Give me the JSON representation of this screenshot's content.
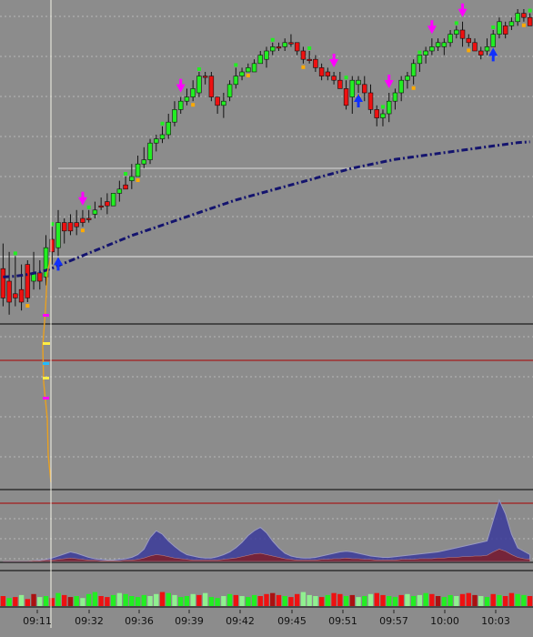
{
  "colors": {
    "background": "#8c8c8c",
    "up_candle": "#22ee22",
    "down_candle": "#ee1111",
    "moving_average": "#14146e",
    "crosshair": "#f5f5e8",
    "signal_arrow_down": "#ff00ff",
    "signal_arrow_up": "#1030ff",
    "volume_light": "#90f090",
    "volume_green": "#22ee22",
    "volume_red": "#ee1111",
    "volume_maroon": "#aa1111"
  },
  "chart_data": [
    {
      "type": "candlestick",
      "panel": "price",
      "grid": true,
      "x": [
        "09:11",
        "09:32",
        "09:36",
        "09:39",
        "09:42",
        "09:45",
        "09:51",
        "09:57",
        "10:00",
        "10:03"
      ],
      "price_scale": {
        "top": 0,
        "bottom": 100
      },
      "candles": [
        [
          62,
          69,
          56,
          71
        ],
        [
          65,
          70,
          58,
          73
        ],
        [
          68,
          69,
          59,
          71
        ],
        [
          67,
          70,
          61,
          72
        ],
        [
          61,
          69,
          60,
          70
        ],
        [
          65,
          63,
          58,
          67
        ],
        [
          63,
          65,
          60,
          67
        ],
        [
          64,
          57,
          54,
          66
        ],
        [
          55,
          58,
          52,
          61
        ],
        [
          57,
          51,
          48,
          59
        ],
        [
          51,
          53,
          50,
          56
        ],
        [
          51,
          53,
          49,
          54
        ],
        [
          51,
          52,
          48,
          54
        ],
        [
          50,
          51,
          48,
          52
        ],
        [
          50,
          50,
          48,
          51
        ],
        [
          49,
          48,
          46,
          50
        ],
        [
          47,
          47,
          45,
          48
        ],
        [
          46,
          47,
          44,
          49
        ],
        [
          47,
          44,
          44,
          45
        ],
        [
          44,
          43,
          41,
          46
        ],
        [
          42,
          43,
          40,
          43
        ],
        [
          41,
          40,
          37,
          43
        ],
        [
          40,
          37,
          35,
          40
        ],
        [
          37,
          36,
          33,
          38
        ],
        [
          36,
          32,
          31,
          37
        ],
        [
          32,
          31,
          30,
          34
        ],
        [
          31,
          30,
          28,
          32
        ],
        [
          30,
          27,
          25,
          31
        ],
        [
          27,
          24,
          22,
          28
        ],
        [
          24,
          22,
          21,
          25
        ],
        [
          22,
          21,
          19,
          23
        ],
        [
          21,
          19,
          17,
          22
        ],
        [
          20,
          16,
          15,
          21
        ],
        [
          16,
          16,
          15,
          18
        ],
        [
          16,
          21,
          15,
          22
        ],
        [
          21,
          23,
          22,
          25
        ],
        [
          23,
          22,
          20,
          26
        ],
        [
          21,
          18,
          17,
          22
        ],
        [
          18,
          16,
          14,
          19
        ],
        [
          16,
          15,
          14,
          17
        ],
        [
          15,
          14,
          13,
          15
        ],
        [
          15,
          13,
          12,
          15
        ],
        [
          13,
          11,
          10,
          13
        ],
        [
          12,
          10,
          9,
          14
        ],
        [
          10,
          9,
          8,
          11
        ],
        [
          9,
          9,
          8,
          10
        ],
        [
          9,
          8,
          7,
          10
        ],
        [
          8,
          8,
          6,
          9
        ],
        [
          8,
          10,
          8,
          11
        ],
        [
          10,
          12,
          9,
          13
        ],
        [
          12,
          12,
          10,
          13
        ],
        [
          12,
          14,
          11,
          15
        ],
        [
          14,
          16,
          13,
          17
        ],
        [
          15,
          16,
          14,
          17
        ],
        [
          16,
          17,
          15,
          18
        ],
        [
          17,
          19,
          15,
          19
        ],
        [
          19,
          23,
          17,
          24
        ],
        [
          21,
          17,
          16,
          25
        ],
        [
          18,
          17,
          16,
          20
        ],
        [
          18,
          20,
          16,
          22
        ],
        [
          20,
          24,
          18,
          25
        ],
        [
          24,
          26,
          23,
          28
        ],
        [
          26,
          25,
          24,
          28
        ],
        [
          25,
          22,
          20,
          27
        ],
        [
          22,
          20,
          19,
          24
        ],
        [
          20,
          17,
          16,
          22
        ],
        [
          17,
          16,
          15,
          19
        ],
        [
          16,
          13,
          12,
          18
        ],
        [
          13,
          11,
          11,
          15
        ],
        [
          11,
          10,
          9,
          13
        ],
        [
          10,
          9,
          7,
          11
        ],
        [
          9,
          8,
          7,
          10
        ],
        [
          9,
          8,
          7,
          11
        ],
        [
          8,
          6,
          5,
          9
        ],
        [
          6,
          5,
          4,
          7
        ],
        [
          5,
          7,
          3,
          9
        ],
        [
          7,
          8,
          6,
          9
        ],
        [
          8,
          10,
          7,
          10
        ],
        [
          10,
          11,
          9,
          12
        ],
        [
          10,
          9,
          7,
          11
        ],
        [
          9,
          6,
          5,
          9
        ],
        [
          6,
          3,
          2,
          7
        ],
        [
          4,
          6,
          3,
          7
        ],
        [
          4,
          3,
          2,
          5
        ],
        [
          3,
          1,
          0,
          4
        ],
        [
          1,
          2,
          0,
          3
        ],
        [
          2,
          4,
          1,
          4
        ]
      ],
      "moving_average": [
        64,
        63.9,
        63.8,
        63.6,
        63.4,
        63.1,
        62.8,
        62.4,
        61.9,
        61.3,
        60.7,
        60.1,
        59.5,
        58.9,
        58.3,
        57.7,
        57.1,
        56.5,
        55.9,
        55.3,
        54.7,
        54.1,
        53.6,
        53.1,
        52.6,
        52.1,
        51.6,
        51.1,
        50.6,
        50.1,
        49.6,
        49.1,
        48.6,
        48.1,
        47.6,
        47.1,
        46.6,
        46.1,
        45.6,
        45.2,
        44.8,
        44.4,
        44.0,
        43.6,
        43.2,
        42.8,
        42.4,
        42.0,
        41.6,
        41.2,
        40.8,
        40.4,
        40.0,
        39.6,
        39.2,
        38.8,
        38.4,
        38.0,
        37.7,
        37.4,
        37.1,
        36.8,
        36.5,
        36.2,
        35.9,
        35.7,
        35.5,
        35.3,
        35.1,
        34.9,
        34.7,
        34.5,
        34.3,
        34.1,
        33.9,
        33.7,
        33.5,
        33.3,
        33.1,
        32.9,
        32.7,
        32.5,
        32.3,
        32.1,
        31.9,
        31.8,
        31.7
      ],
      "signals": [
        {
          "index": 13,
          "dir": "down"
        },
        {
          "index": 29,
          "dir": "down"
        },
        {
          "index": 54,
          "dir": "down"
        },
        {
          "index": 63,
          "dir": "down"
        },
        {
          "index": 70,
          "dir": "down"
        },
        {
          "index": 75,
          "dir": "down"
        },
        {
          "index": 9,
          "dir": "up"
        },
        {
          "index": 58,
          "dir": "up"
        },
        {
          "index": 80,
          "dir": "up"
        }
      ]
    },
    {
      "type": "area",
      "panel": "indicator",
      "series": [
        {
          "values": [
            0,
            0,
            0,
            0,
            0,
            1,
            2,
            3,
            5,
            8,
            11,
            14,
            12,
            9,
            6,
            4,
            3,
            2,
            2,
            3,
            4,
            6,
            10,
            18,
            35,
            45,
            40,
            30,
            22,
            15,
            10,
            8,
            6,
            5,
            5,
            7,
            10,
            14,
            20,
            28,
            38,
            45,
            50,
            42,
            30,
            20,
            12,
            8,
            6,
            5,
            5,
            6,
            8,
            10,
            12,
            14,
            15,
            14,
            12,
            10,
            8,
            7,
            6,
            6,
            7,
            8,
            9,
            10,
            11,
            12,
            13,
            14,
            16,
            18,
            20,
            22,
            24,
            26,
            28,
            30,
            60,
            90,
            70,
            40,
            20,
            15,
            10
          ]
        },
        {
          "values": [
            0,
            0,
            0,
            0,
            0,
            1,
            1,
            2,
            2,
            3,
            4,
            5,
            4,
            3,
            2,
            2,
            1,
            1,
            1,
            1,
            2,
            2,
            3,
            5,
            8,
            10,
            9,
            7,
            5,
            4,
            3,
            2,
            2,
            2,
            2,
            2,
            3,
            4,
            5,
            7,
            9,
            11,
            12,
            10,
            8,
            6,
            4,
            3,
            2,
            2,
            2,
            2,
            3,
            3,
            4,
            4,
            5,
            4,
            4,
            3,
            3,
            2,
            2,
            2,
            2,
            3,
            3,
            3,
            4,
            4,
            4,
            5,
            5,
            6,
            6,
            7,
            7,
            8,
            8,
            9,
            14,
            18,
            15,
            10,
            6,
            4,
            3
          ]
        }
      ]
    },
    {
      "type": "bar",
      "panel": "volume",
      "values": [
        10,
        8,
        9,
        11,
        7,
        12,
        9,
        10,
        8,
        13,
        11,
        9,
        10,
        8,
        12,
        14,
        10,
        9,
        11,
        13,
        12,
        10,
        9,
        11,
        10,
        12,
        14,
        13,
        11,
        9,
        10,
        12,
        11,
        13,
        9,
        8,
        10,
        12,
        11,
        10,
        9,
        11,
        10,
        12,
        13,
        11,
        10,
        9,
        12,
        14,
        11,
        10,
        9,
        11,
        13,
        12,
        10,
        11,
        9,
        10,
        12,
        13,
        11,
        10,
        9,
        11,
        12,
        10,
        11,
        13,
        12,
        10,
        9,
        11,
        10,
        12,
        13,
        11,
        10,
        9,
        12,
        11,
        10,
        13,
        12,
        11,
        10
      ],
      "colors": [
        "red",
        "green",
        "red",
        "light",
        "red",
        "maroon",
        "light",
        "green",
        "red",
        "green",
        "red",
        "maroon",
        "green",
        "light",
        "green",
        "green",
        "red",
        "red",
        "green",
        "light",
        "green",
        "green",
        "green",
        "green",
        "light",
        "light",
        "red",
        "green",
        "light",
        "green",
        "green",
        "light",
        "red",
        "light",
        "green",
        "green",
        "light",
        "green",
        "red",
        "light",
        "green",
        "green",
        "red",
        "red",
        "maroon",
        "red",
        "green",
        "red",
        "red",
        "light",
        "light",
        "light",
        "red",
        "green",
        "red",
        "red",
        "green",
        "maroon",
        "light",
        "green",
        "light",
        "red",
        "red",
        "green",
        "green",
        "red",
        "light",
        "green",
        "light",
        "green",
        "red",
        "maroon",
        "green",
        "green",
        "light",
        "red",
        "red",
        "maroon",
        "light",
        "green",
        "red",
        "green",
        "red",
        "red",
        "green",
        "green",
        "red"
      ]
    }
  ]
}
